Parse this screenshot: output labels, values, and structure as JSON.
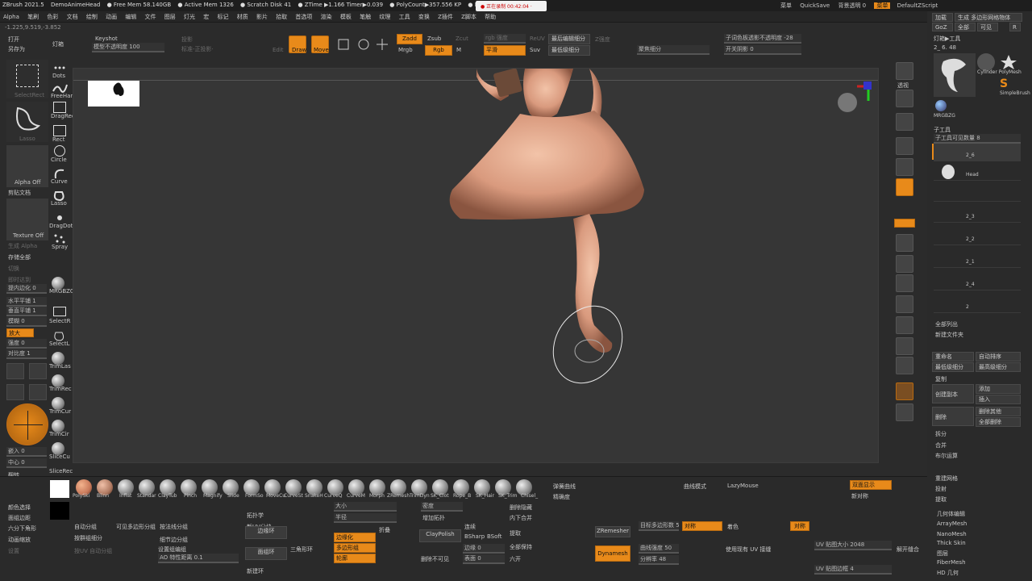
{
  "title_bar": {
    "items": [
      "ZBrush 2021.5",
      "DemoAnimeHead",
      "● Free Mem 58.140GB",
      "● Active Mem 1326",
      "● Scratch Disk 41",
      "● ZTime ▶1.166 Timer▶0.039",
      "● PolyCount▶357.556 KP",
      "● MeshCount▶9"
    ],
    "recording": "● 正在录制 00:42:04 ·",
    "right": [
      "菜单",
      "QuickSave",
      "背景透明 0",
      "菜单",
      "DefaultZScript"
    ]
  },
  "menubar": {
    "items": [
      "Alpha",
      "笔刷",
      "色彩",
      "文档",
      "绘制",
      "动画",
      "编辑",
      "文件",
      "图层",
      "灯光",
      "宏",
      "标记",
      "材质",
      "影片",
      "拾取",
      "首选项",
      "渲染",
      "模板",
      "笔触",
      "纹理",
      "工具",
      "变换",
      "Z插件",
      "Z脚本",
      "帮助"
    ]
  },
  "coords": "-1.225,9.519,-3.852",
  "top_left": {
    "open": "打开",
    "save_as": "另存为",
    "light": "灯箱"
  },
  "top_toolbar": {
    "keyshot": "Keyshot",
    "keyshot_sub": "模型不透明度 100",
    "proj": "投影",
    "projdim": "标准-正投影·",
    "edit": "Edit",
    "draw": "Draw",
    "move": "Move",
    "zadd": "Zadd",
    "zsub": "Zsub",
    "zcut": "Zcut",
    "mrgb": "Mrgb",
    "rgb": "Rgb",
    "m": "M",
    "rgb_intensity": "rgb 强度",
    "smooth": "平滑",
    "suv": "Suv",
    "rsuv": "ReUV",
    "poly_sub": "最后编辑细分",
    "hide_sub": "最低级细分",
    "z_intensity": "Z强度",
    "focal": "聚焦细分",
    "fade": "子词色板透影不透明度 -28",
    "open_shadow": "开关阴影 0"
  },
  "left_tools": {
    "selectrect": "SelectRect",
    "lasso": "Lasso",
    "alpha_off": "Alpha Off",
    "texture_off": "Texture Off",
    "dots": "Dots",
    "freehand": "FreeHand",
    "dragrect": "DragRect",
    "rect": "Rect",
    "circle": "Circle",
    "curve": "Curve",
    "lasso2": "Lasso",
    "dragdot": "DragDot",
    "spray": "Spray",
    "mrgbzgrabber": "MRGBZGr",
    "selectr": "SelectR",
    "selectl": "SelectL",
    "trimlas": "TrimLas",
    "trimrec": "TrimRec",
    "trimcur": "TrimCur",
    "trimcir": "TrimCir",
    "slicecu": "SliceCu",
    "slicerec": "SliceRec",
    "labels": [
      "剪贴文档",
      "生成 Alpha",
      "存储全部",
      "切换",
      "即时达到",
      "提内边化 0",
      "水平平铺 1",
      "垂直平铺 1",
      "模糊 0",
      "强度 0",
      "放大",
      "对比度 1",
      "嵌入 0",
      "中心 0",
      "翻转"
    ]
  },
  "right_shelf": {
    "labels": [
      "透视",
      "平面",
      "画布",
      "地面",
      "网格",
      "透视",
      "Frame",
      "Move",
      "Scale",
      "Rotate",
      "Line Fill",
      "Transp",
      "Ghost",
      "Solo",
      "Dynamic"
    ]
  },
  "right_panel": {
    "header_btns": [
      "加载",
      "生成 多边形网格物体",
      "复制",
      "GoZ",
      "全部",
      "可见",
      "R"
    ],
    "tool_title": "灯箱▶工具",
    "tool_count": "2_ 6. 48",
    "thumbs": [
      "Cylinder PolyMesh",
      "SimpleBrush",
      "MRGBZG"
    ],
    "subtool_title": "子工具",
    "subtool_count": "子工具可见数量 8",
    "subtools": [
      "2_6",
      "Head",
      "2_3",
      "2_2",
      "2_1",
      "2_4",
      "2"
    ],
    "all_list": "全部列出",
    "new_folder": "新建文件夹",
    "rename": "重命名",
    "auto_sort": "自动排序",
    "lowest": "最低级细分",
    "highest": "最高级细分",
    "copy": "复制",
    "create_copy": "创建副本",
    "add": "添加",
    "insert": "插入",
    "delete": "删除",
    "delete_other": "删除其他",
    "del_all": "全部删除",
    "split": "拆分",
    "merge": "合并",
    "boolean": "布尔运算",
    "remesh": "重建网格",
    "project": "投射",
    "extract": "提取",
    "list": [
      "几何体编辑",
      "ArrayMesh",
      "NanoMesh",
      "Thick Skin",
      "图层",
      "FiberMesh",
      "HD 几何"
    ]
  },
  "bottom": {
    "brushes": [
      "PolySki",
      "Blinn",
      "Inflat",
      "Standar",
      "ClayTub",
      "Pinch",
      "Magnify",
      "Slide",
      "FormSo",
      "MoveCu",
      "CurveSt",
      "SnakeH",
      "CurveQ",
      "CurveM",
      "Morph",
      "ZRemesh",
      "TrimDyn",
      "SK_Clot",
      "Rope_B",
      "SK_Hair",
      "SK_Trim",
      "Chisel_"
    ],
    "col1": [
      "颜色选择",
      "面组边距",
      "六分下角形",
      "动画缩放",
      "设置"
    ],
    "col2": [
      "自动分组",
      "可见多边形分组",
      "按法线分组",
      "按群组细分",
      "细节边分组",
      "AO 特性距离 0.1",
      "设置组编组",
      "按UV 自动分组"
    ],
    "col3": [
      "拓扑学",
      "新UV分块",
      "边缘环",
      "面组环",
      "三角形环",
      "新建环"
    ],
    "col4": [
      "大小",
      "半径",
      "折叠",
      "边缘化",
      "多边形组",
      "轮廓"
    ],
    "col5": [
      "密度",
      "增加拓扑",
      "ClayPolish",
      "删除不可见"
    ],
    "col6": [
      "连续",
      "BSharp",
      "BSoft",
      "边缘 0",
      "表面 0"
    ],
    "col7": [
      "删除隐藏",
      "内下合并",
      "提取",
      "全部保持",
      "六开"
    ],
    "col8": [
      "弹簧曲线",
      "精确度",
      "ZRemesher",
      "Dynamesh"
    ],
    "col9": [
      "目标多边形数 5",
      "曲线强度 50",
      "分辨率 48"
    ],
    "col10": [
      "曲线模式",
      "对称",
      "着色",
      "LazyMouse"
    ],
    "col11": [
      "双面显示",
      "新对称",
      "使用现有 UV 接缝",
      "对称"
    ],
    "col12": [
      "UV 贴图大小 2048",
      "UV 贴图边框 4",
      "解开缝合"
    ]
  },
  "viewport": {
    "mini_nav": "透视"
  }
}
